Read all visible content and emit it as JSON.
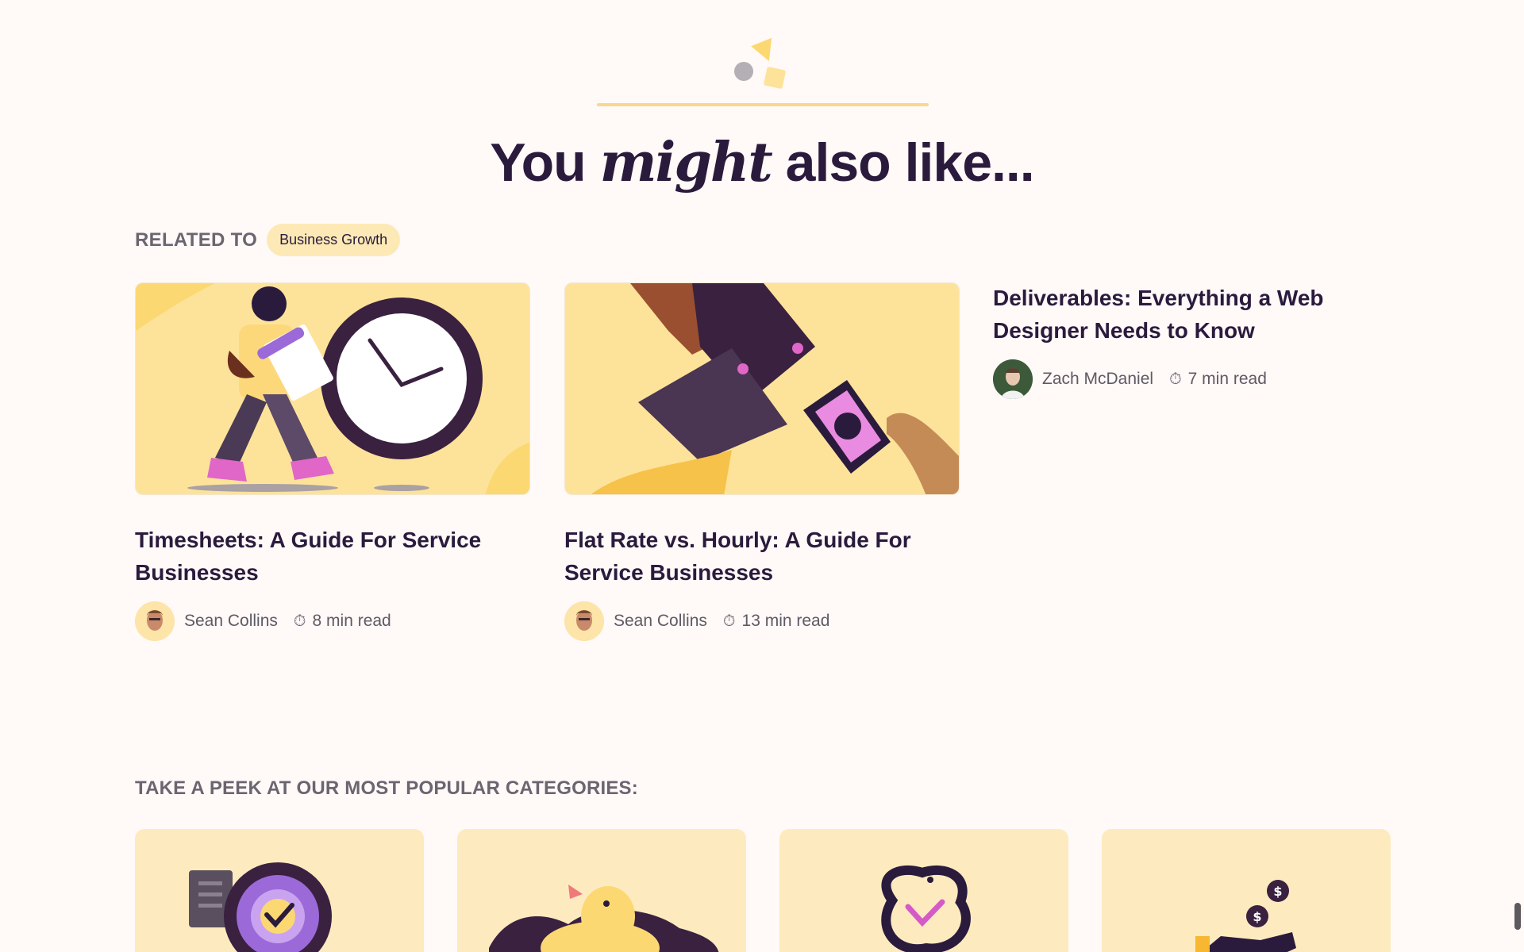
{
  "section": {
    "headline_before": "You ",
    "headline_em": "might",
    "headline_after": " also like...",
    "related_label": "RELATED TO",
    "related_tag": "Business Growth"
  },
  "articles": [
    {
      "title": "Timesheets: A Guide For Service Businesses",
      "author": "Sean Collins",
      "read_time": "8 min read"
    },
    {
      "title": "Flat Rate vs. Hourly: A Guide For Service Businesses",
      "author": "Sean Collins",
      "read_time": "13 min read"
    },
    {
      "title": "Deliverables: Everything a Web Designer Needs to Know",
      "author": "Zach McDaniel",
      "read_time": "7 min read"
    }
  ],
  "categories": {
    "heading": "TAKE A PEEK AT OUR MOST POPULAR CATEGORIES:"
  },
  "icons": {
    "decor": "shapes-icon",
    "timer": "stopwatch-icon"
  },
  "colors": {
    "background": "#fff9f8",
    "accent_yellow": "#fcd873",
    "text_dark": "#2a1b3d",
    "tag_bg": "#fde9b5"
  }
}
